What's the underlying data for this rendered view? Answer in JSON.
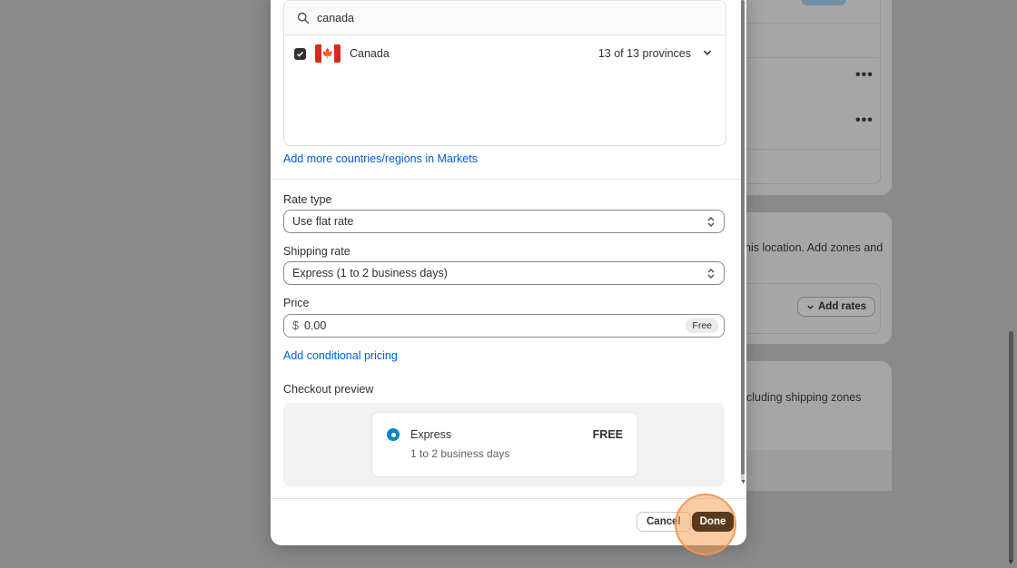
{
  "background": {
    "partial_text_1": "his location. Add zones and",
    "partial_text_2": "cluding shipping zones",
    "add_rates_label": "Add rates"
  },
  "modal": {
    "search": {
      "value": "canada",
      "placeholder": ""
    },
    "country": {
      "name": "Canada",
      "provinces": "13 of 13 provinces",
      "checked": true
    },
    "add_markets_link": "Add more countries/regions in Markets",
    "rate_type": {
      "label": "Rate type",
      "value": "Use flat rate"
    },
    "shipping_rate": {
      "label": "Shipping rate",
      "value": "Express (1 to 2 business days)"
    },
    "price": {
      "label": "Price",
      "currency": "$",
      "value": "0.00",
      "badge": "Free"
    },
    "conditional_link": "Add conditional pricing",
    "checkout_preview": {
      "label": "Checkout preview",
      "option_title": "Express",
      "option_sub": "1 to 2 business days",
      "option_price": "FREE"
    },
    "footer": {
      "cancel": "Cancel",
      "done": "Done"
    }
  },
  "colors": {
    "primary_button": "#5b3a1c",
    "link": "#005bd3",
    "radio": "#0a84c6",
    "highlight": "#f7a05a"
  }
}
